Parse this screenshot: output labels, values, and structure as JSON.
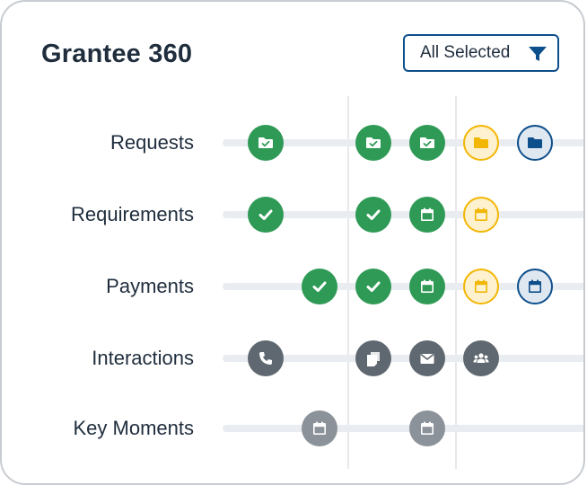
{
  "title": "Grantee 360",
  "filter": {
    "label": "All Selected",
    "icon": "funnel-icon",
    "color": "#0d4f8b"
  },
  "colors": {
    "green": "#2e9a55",
    "yellow": "#f2b705",
    "yellow_bg": "#fdf1cf",
    "blue": "#0d4f8b",
    "blue_bg": "#dfe7f1",
    "gray": "#5f6870",
    "lightgray": "#8b9299"
  },
  "rows": [
    {
      "label": "Requests",
      "items": [
        {
          "col": 0,
          "icon": "folder-check-icon",
          "style": "green"
        },
        {
          "col": 2,
          "icon": "folder-check-icon",
          "style": "green"
        },
        {
          "col": 3,
          "icon": "folder-check-icon",
          "style": "green"
        },
        {
          "col": 4,
          "icon": "folder-icon",
          "style": "yellow-outline"
        },
        {
          "col": 5,
          "icon": "folder-icon",
          "style": "blue-outline"
        }
      ]
    },
    {
      "label": "Requirements",
      "items": [
        {
          "col": 0,
          "icon": "check-icon",
          "style": "green"
        },
        {
          "col": 2,
          "icon": "check-icon",
          "style": "green"
        },
        {
          "col": 3,
          "icon": "calendar-icon",
          "style": "green"
        },
        {
          "col": 4,
          "icon": "calendar-icon",
          "style": "yellow-outline"
        }
      ]
    },
    {
      "label": "Payments",
      "items": [
        {
          "col": 1,
          "icon": "check-icon",
          "style": "green"
        },
        {
          "col": 2,
          "icon": "check-icon",
          "style": "green"
        },
        {
          "col": 3,
          "icon": "calendar-icon",
          "style": "green"
        },
        {
          "col": 4,
          "icon": "calendar-icon",
          "style": "yellow-outline"
        },
        {
          "col": 5,
          "icon": "calendar-icon",
          "style": "blue-outline"
        }
      ]
    },
    {
      "label": "Interactions",
      "items": [
        {
          "col": 0,
          "icon": "phone-icon",
          "style": "gray"
        },
        {
          "col": 2,
          "icon": "notes-icon",
          "style": "gray"
        },
        {
          "col": 3,
          "icon": "envelope-icon",
          "style": "gray"
        },
        {
          "col": 4,
          "icon": "people-icon",
          "style": "gray"
        }
      ]
    },
    {
      "label": "Key Moments",
      "items": [
        {
          "col": 1,
          "icon": "calendar-icon",
          "style": "lightgray"
        },
        {
          "col": 3,
          "icon": "calendar-icon",
          "style": "lightgray"
        }
      ]
    }
  ]
}
